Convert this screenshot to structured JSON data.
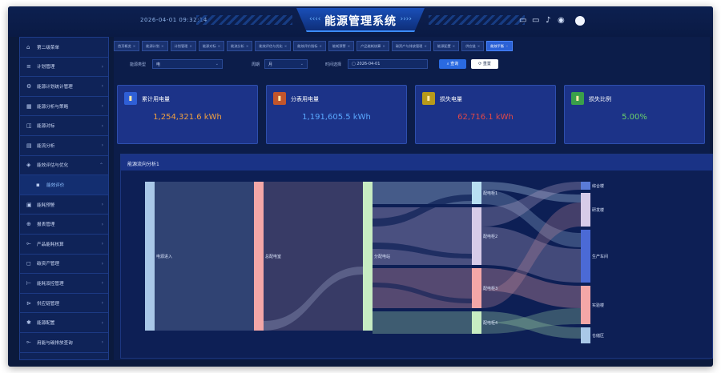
{
  "header": {
    "datetime": "2026-04-01 09:32:14",
    "title": "能源管理系统",
    "arrows_left": "‹‹‹‹",
    "arrows_right": "››››",
    "icons": [
      "monitor-icon",
      "display-icon",
      "bell-icon",
      "help-icon",
      "user-avatar"
    ]
  },
  "sidebar": {
    "items": [
      {
        "label": "第二级菜单",
        "icon": "home-icon",
        "glyph": "⌂",
        "chevron": ""
      },
      {
        "label": "计划管理",
        "icon": "list-icon",
        "glyph": "≡",
        "chevron": "›"
      },
      {
        "label": "能源计划统计管理",
        "icon": "gear-icon",
        "glyph": "⚙",
        "chevron": "›"
      },
      {
        "label": "能源分析与策略",
        "icon": "chart-icon",
        "glyph": "▦",
        "chevron": "›"
      },
      {
        "label": "能源对标",
        "icon": "compare-icon",
        "glyph": "◫",
        "chevron": "›"
      },
      {
        "label": "能流分析",
        "icon": "flow-icon",
        "glyph": "▤",
        "chevron": "›"
      },
      {
        "label": "能效评估与优化",
        "icon": "optimize-icon",
        "glyph": "◈",
        "chevron": "⌃"
      },
      {
        "label": "能效评价",
        "icon": "eval-icon",
        "glyph": "▪",
        "chevron": "",
        "sub": true
      },
      {
        "label": "能耗预警",
        "icon": "warn-icon",
        "glyph": "▣",
        "chevron": "›"
      },
      {
        "label": "报表管理",
        "icon": "report-icon",
        "glyph": "⊕",
        "chevron": "›"
      },
      {
        "label": "产品能耗核算",
        "icon": "product-icon",
        "glyph": "⟜",
        "chevron": "›"
      },
      {
        "label": "碳资产管理",
        "icon": "carbon-icon",
        "glyph": "◻",
        "chevron": "›"
      },
      {
        "label": "能耗双控管理",
        "icon": "control-icon",
        "glyph": "⊢",
        "chevron": "›"
      },
      {
        "label": "供应链管理",
        "icon": "supply-icon",
        "glyph": "⊳",
        "chevron": "›"
      },
      {
        "label": "能源配置",
        "icon": "config-icon",
        "glyph": "✱",
        "chevron": "›"
      },
      {
        "label": "用能与碳排放查询",
        "icon": "query-icon",
        "glyph": "⟜",
        "chevron": "›"
      }
    ]
  },
  "tabs": [
    {
      "label": "首页概览",
      "active": false
    },
    {
      "label": "能源计划",
      "active": false
    },
    {
      "label": "计划管理",
      "active": false
    },
    {
      "label": "能源对标",
      "active": false
    },
    {
      "label": "能流分析",
      "active": false
    },
    {
      "label": "能效评估与优化",
      "active": false
    },
    {
      "label": "能效评价指标",
      "active": false
    },
    {
      "label": "能耗预警",
      "active": false
    },
    {
      "label": "产品能耗核算",
      "active": false
    },
    {
      "label": "碳资产与排放管理",
      "active": false
    },
    {
      "label": "能源配置",
      "active": false
    },
    {
      "label": "供应链",
      "active": false
    },
    {
      "label": "能效平衡",
      "active": true
    }
  ],
  "filters": {
    "energy_type_label": "能源类型",
    "energy_type_value": "电",
    "period_label": "周期",
    "period_value": "月",
    "time_label": "时间选择",
    "time_value": "2026-04-01",
    "query_label": "查询",
    "reset_label": "重置"
  },
  "cards": [
    {
      "title": "累计用电量",
      "value": "1,254,321.6 kWh",
      "icon": "bar-chart-icon",
      "icon_bg": "#2f5fd6",
      "value_color": "#f0a040"
    },
    {
      "title": "分表用电量",
      "value": "1,191,605.5 kWh",
      "icon": "bar-chart-icon",
      "icon_bg": "#c2552b",
      "value_color": "#5aa8ff"
    },
    {
      "title": "损失电量",
      "value": "62,716.1 kWh",
      "icon": "bar-chart-icon",
      "icon_bg": "#b89a1a",
      "value_color": "#e04848"
    },
    {
      "title": "损失比例",
      "value": "5.00%",
      "icon": "bar-chart-icon",
      "icon_bg": "#3aa04a",
      "value_color": "#6ad06a"
    }
  ],
  "flow_panel": {
    "title": "能源流向分析1",
    "node_labels": [
      "电源进入",
      "总配电室",
      "分配电站",
      "配电柜1",
      "配电柜2",
      "配电柜3",
      "配电柜4",
      "综合楼",
      "研发楼",
      "生产车间",
      "实验楼",
      "仓储区"
    ],
    "node_colors": [
      "#a9c8e8",
      "#f4a7a7",
      "#c7ecc2",
      "#b8dff2",
      "#d7cbe8",
      "#f4a7a7",
      "#c7ecc2",
      "#5a7bd8",
      "#d7cbe8",
      "#4b6ad6",
      "#f4a7a7",
      "#a9c8e8"
    ]
  }
}
